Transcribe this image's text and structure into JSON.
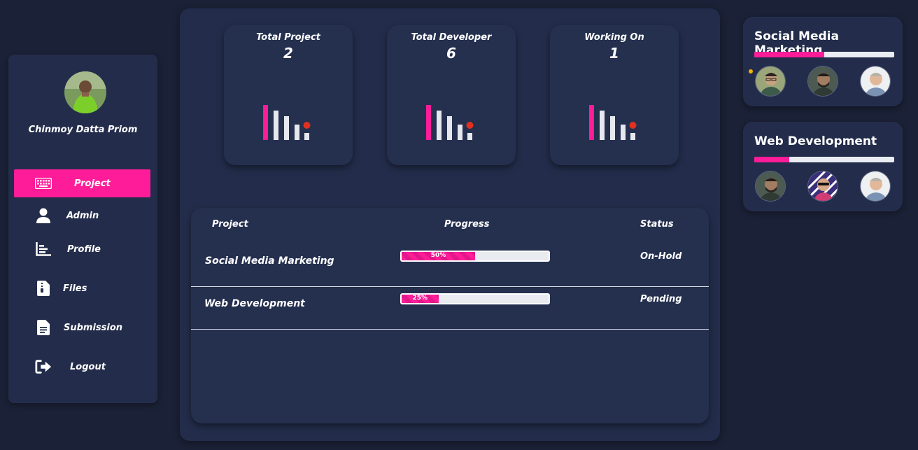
{
  "user": {
    "name": "Chinmoy Datta Priom"
  },
  "nav": {
    "items": [
      {
        "label": "Project",
        "icon": "keyboard-icon",
        "active": true
      },
      {
        "label": "Admin",
        "icon": "user-icon",
        "active": false
      },
      {
        "label": "Profile",
        "icon": "chart-icon",
        "active": false
      },
      {
        "label": "Files",
        "icon": "file-zip-icon",
        "active": false
      },
      {
        "label": "Submission",
        "icon": "document-icon",
        "active": false
      },
      {
        "label": "Logout",
        "icon": "logout-icon",
        "active": false
      }
    ]
  },
  "stats": [
    {
      "label": "Total Project",
      "value": "2"
    },
    {
      "label": "Total Developer",
      "value": "6"
    },
    {
      "label": "Working On",
      "value": "1"
    }
  ],
  "table": {
    "headers": {
      "project": "Project",
      "progress": "Progress",
      "status": "Status"
    },
    "rows": [
      {
        "name": "Social Media Marketing",
        "progress": 50,
        "progress_label": "50%",
        "status": "On-Hold"
      },
      {
        "name": "Web Development",
        "progress": 25,
        "progress_label": "25%",
        "status": "Pending"
      }
    ]
  },
  "projects": [
    {
      "title": "Social Media Marketing",
      "progress": 50
    },
    {
      "title": "Web Development",
      "progress": 25
    }
  ],
  "colors": {
    "accent": "#ff1c98",
    "background": "#1b2136",
    "panel": "#232d4b",
    "online": "#f5b400",
    "chart_dot": "#e0301e"
  }
}
